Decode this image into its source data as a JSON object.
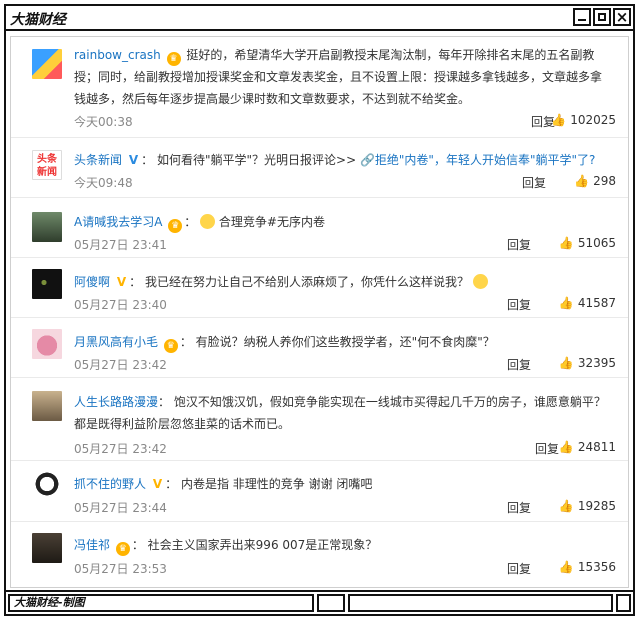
{
  "window": {
    "title": "大猫财经"
  },
  "statusbar": {
    "credit": "大猫财经-制图"
  },
  "actions": {
    "reply_label": "回复"
  },
  "comments": [
    {
      "user": "rainbow_crash",
      "text": "挺好的，希望清华大学开启副教授末尾淘汰制，每年开除排名末尾的五名副教授；同时，给副教授增加授课奖金和文章发表奖金，且不设置上限：授课越多拿钱越多，文章越多拿钱越多，然后每年逐步提高最少课时数和文章数要求，不达到就不给奖金。",
      "time": "今天00:38",
      "likes": "102025"
    },
    {
      "user": "头条新闻",
      "text_before": "如何看待\"躺平学\"？光明日报评论>>",
      "link": "拒绝\"内卷\"，年轻人开始信奉\"躺平学\"了?",
      "time": "今天09:48",
      "likes": "298"
    },
    {
      "user": "A请喊我去学习A",
      "text": "合理竞争#无序内卷",
      "time": "05月27日 23:41",
      "likes": "51065"
    },
    {
      "user": "阿傻啊",
      "text": "我已经在努力让自己不给别人添麻烦了，你凭什么这样说我？",
      "time": "05月27日 23:40",
      "likes": "41587"
    },
    {
      "user": "月黑风高有小毛",
      "text": "有脸说？纳税人养你们这些教授学者，还\"何不食肉糜\"？",
      "time": "05月27日 23:42",
      "likes": "32395"
    },
    {
      "user": "人生长路路漫漫",
      "text": "饱汉不知饿汉饥，假如竞争能实现在一线城市买得起几千万的房子，谁愿意躺平？都是既得利益阶层忽悠韭菜的话术而已。",
      "time": "05月27日 23:42",
      "likes": "24811"
    },
    {
      "user": "抓不住的野人",
      "text": "内卷是指 非理性的竞争 谢谢 闭嘴吧",
      "time": "05月27日 23:44",
      "likes": "19285"
    },
    {
      "user": "冯佳祁",
      "text": "社会主义国家弄出来996 007是正常现象？",
      "time": "05月27日 23:53",
      "likes": "15356"
    }
  ]
}
